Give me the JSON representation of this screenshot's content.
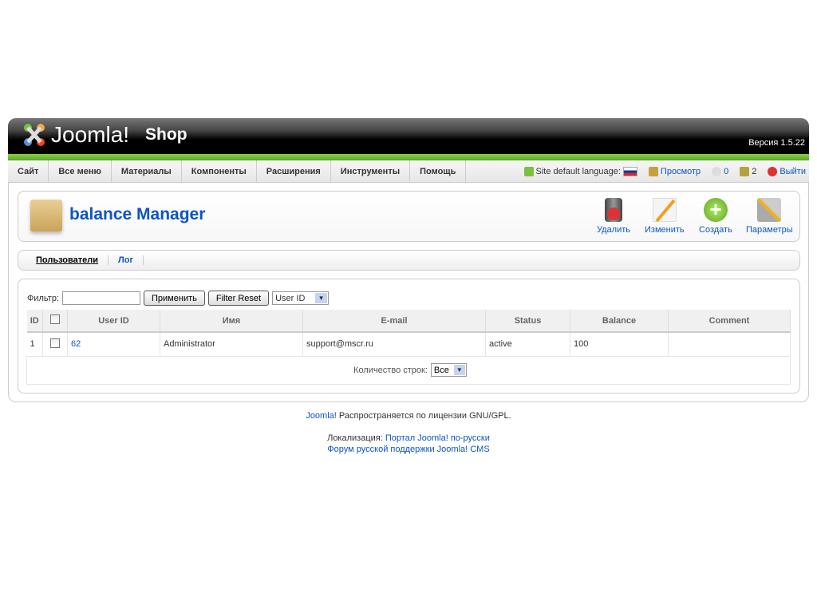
{
  "header": {
    "logo_text": "Joomla!",
    "site_name": "Shop",
    "version": "Версия 1.5.22"
  },
  "menu": [
    "Сайт",
    "Все меню",
    "Материалы",
    "Компоненты",
    "Расширения",
    "Инструменты",
    "Помощь"
  ],
  "status": {
    "language_label": "Site default language:",
    "preview": "Просмотр",
    "messages": "0",
    "users": "2",
    "logout": "Выйти"
  },
  "toolbar": {
    "title": "balance Manager",
    "buttons": [
      "Удалить",
      "Изменить",
      "Создать",
      "Параметры"
    ]
  },
  "subnav": [
    "Пользователи",
    "Лог"
  ],
  "filter": {
    "label": "Фильтр:",
    "value": "",
    "apply": "Применить",
    "reset": "Filter Reset",
    "sort": "User ID"
  },
  "table": {
    "headers": [
      "ID",
      "User ID",
      "Имя",
      "E-mail",
      "Status",
      "Balance",
      "Comment"
    ],
    "rows": [
      {
        "id": "1",
        "user_id": "62",
        "name": "Administrator",
        "email": "support@mscr.ru",
        "status": "active",
        "balance": "100",
        "comment": ""
      }
    ],
    "rows_label": "Количество строк:",
    "rows_value": "Все"
  },
  "footer": {
    "joomla": "Joomla!",
    "license": " Распространяется по лицензии GNU/GPL.",
    "loc_label": "Локализация: ",
    "loc_link": "Портал Joomla! по-русски",
    "forum": "Форум русской поддержки Joomla! CMS"
  },
  "colors": {
    "accent": "#0b55c4",
    "green": "#6abf3a"
  }
}
